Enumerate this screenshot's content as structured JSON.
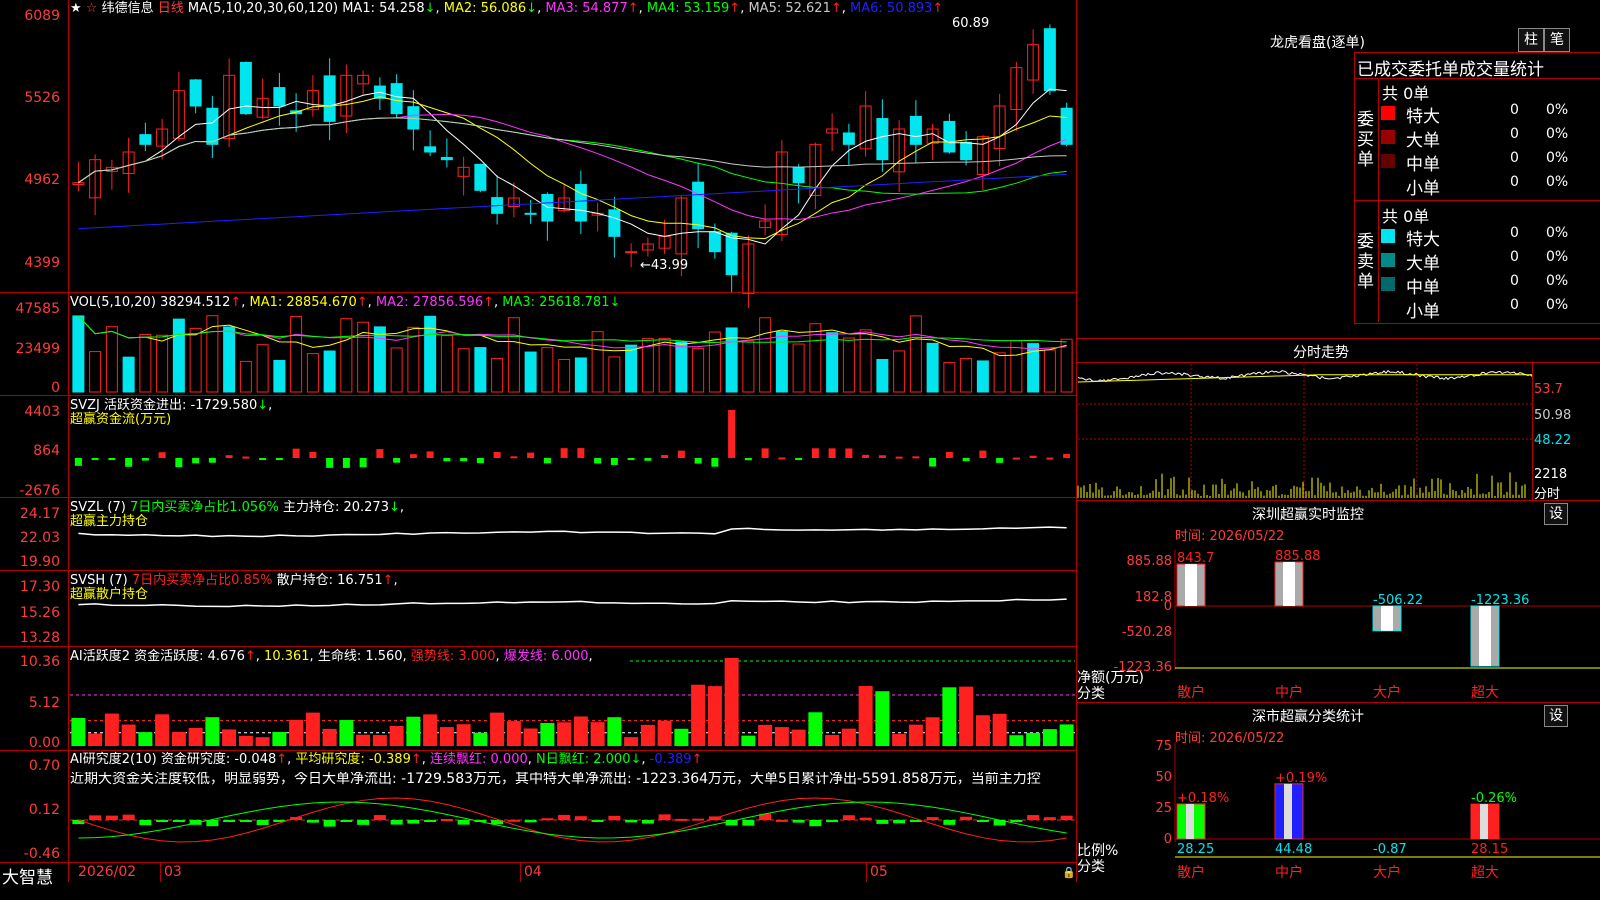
{
  "colors": {
    "up": "#ff2020",
    "down": "#00e5ee",
    "grid": "#b00000",
    "axis": "#ff3b3b",
    "yellow": "#ffff00",
    "magenta": "#ff33ff",
    "green": "#00ff00",
    "blue": "#2020ff",
    "white": "#ffffff",
    "gray": "#c8c8c8"
  },
  "main": {
    "title_stock": "纬德信息",
    "title_period": "日线",
    "ma_params": "MA(5,10,20,30,60,120)",
    "ma": [
      {
        "label": "MA1: 54.258",
        "arrow": "↓",
        "color": "#ffffff"
      },
      {
        "label": "MA2: 56.086",
        "arrow": "↓",
        "color": "#ffff00"
      },
      {
        "label": "MA3: 54.877",
        "arrow": "↑",
        "color": "#ff33ff"
      },
      {
        "label": "MA4: 53.159",
        "arrow": "↑",
        "color": "#00ff00"
      },
      {
        "label": "MA5: 52.621",
        "arrow": "↑",
        "color": "#c8c8c8"
      },
      {
        "label": "MA6: 50.893",
        "arrow": "↑",
        "color": "#2020ff"
      }
    ],
    "yaxis": [
      "6089",
      "5526",
      "4962",
      "4399"
    ],
    "high_note": "60.89",
    "low_note": "43.99"
  },
  "vol": {
    "title": "VOL(5,10,20)",
    "value": "38294.512",
    "arrow": "↑",
    "ma": [
      {
        "label": "MA1: 28854.670",
        "arrow": "↑",
        "color": "#ffff00"
      },
      {
        "label": "MA2: 27856.596",
        "arrow": "↑",
        "color": "#ff33ff"
      },
      {
        "label": "MA3: 25618.781",
        "arrow": "↓",
        "color": "#00ff00"
      }
    ],
    "yaxis": [
      "47585",
      "23499",
      "0"
    ]
  },
  "svzj": {
    "title": "SVZJ  活跃资金进出: -1729.580",
    "arrow": "↓",
    "suffix": ",",
    "sub": "超赢资金流(万元)",
    "yaxis": [
      "4403",
      "864",
      "-2676"
    ]
  },
  "svzl": {
    "title": "SVZL (7)",
    "pct": "7日内买卖净占比1.056%",
    "label": "主力持仓: 20.273",
    "arrow": "↓",
    "suffix": ",",
    "sub": "超赢主力持仓",
    "yaxis": [
      "24.17",
      "22.03",
      "19.90"
    ]
  },
  "svsh": {
    "title": "SVSH (7)",
    "pct": "7日内买卖净占比0.85%",
    "label": "散户持仓: 16.751",
    "arrow": "↑",
    "suffix": ",",
    "sub": "超赢散户持仓",
    "yaxis": [
      "17.30",
      "15.26",
      "13.28"
    ]
  },
  "ai_active": {
    "title": "AI活跃度2",
    "l1": "资金活跃度: 4.676",
    "a1": "↑",
    "l2": "10.361",
    "l3": "生命线: 1.560",
    "l4": "强势线: 3.000",
    "l5": "爆发线: 6.000",
    "yaxis": [
      "10.36",
      "5.12",
      "0.00"
    ]
  },
  "ai_research": {
    "title": "AI研究度2(10)",
    "l1": "资金研究度: -0.048",
    "a1": "↑",
    "l2": "平均研究度: -0.389",
    "a2": "↑",
    "l3": "连续飘红: 0.000",
    "l4": "N日飘红: 2.000",
    "a4": "↓",
    "l5": "-0.389",
    "a5": "↑",
    "comment": "近期大资金关注度较低，明显弱势，今日大单净流出: -1729.583万元，其中特大单净流出: -1223.364万元，大单5日累计净出-5591.858万元，当前主力控",
    "yaxis": [
      "0.70",
      "0.12",
      "-0.46"
    ]
  },
  "bottom": {
    "brand": "大智慧",
    "dates": [
      "2026/02",
      "03",
      "04",
      "05"
    ]
  },
  "lhb": {
    "title": "龙虎看盘(逐单)",
    "btn1": "柱",
    "btn2": "笔",
    "header": "已成交委托单成交量统计",
    "buy_label": "委买单",
    "sell_label": "委卖单",
    "buy_total": "共 0单",
    "sell_total": "共 0单",
    "buy_rows": [
      {
        "name": "特大",
        "val": "0",
        "pct": "0%",
        "color": "#ff0000"
      },
      {
        "name": "大单",
        "val": "0",
        "pct": "0%",
        "color": "#990000"
      },
      {
        "name": "中单",
        "val": "0",
        "pct": "0%",
        "color": "#660000"
      },
      {
        "name": "小单",
        "val": "0",
        "pct": "0%",
        "color": ""
      }
    ],
    "sell_rows": [
      {
        "name": "特大",
        "val": "0",
        "pct": "0%",
        "color": "#00e5ee"
      },
      {
        "name": "大单",
        "val": "0",
        "pct": "0%",
        "color": "#008b8b"
      },
      {
        "name": "中单",
        "val": "0",
        "pct": "0%",
        "color": "#006a6a"
      },
      {
        "name": "小单",
        "val": "0",
        "pct": "0%",
        "color": ""
      }
    ]
  },
  "fenshi": {
    "title": "分时走势",
    "yaxis": [
      "53.7",
      "50.98",
      "48.22",
      "2218",
      "分时"
    ]
  },
  "szmon": {
    "title": "深圳超赢实时监控",
    "btn": "设",
    "time": "时间: 2026/05/22",
    "yaxis": [
      "885.88",
      "182.8",
      "0",
      "-520.28",
      "-1223.36"
    ],
    "ylabel": "净额(万元)",
    "xlabel": "分类",
    "cats": [
      {
        "name": "散户",
        "val": "843.7",
        "num": 843.7
      },
      {
        "name": "中户",
        "val": "885.88",
        "num": 885.88
      },
      {
        "name": "大户",
        "val": "-506.22",
        "num": -506.22
      },
      {
        "name": "超大",
        "val": "-1223.36",
        "num": -1223.36
      }
    ]
  },
  "szcls": {
    "title": "深市超赢分类统计",
    "btn": "设",
    "time": "时间: 2026/05/22",
    "yaxis": [
      "75",
      "50",
      "25",
      "0"
    ],
    "ylabel": "比例%",
    "xlabel": "分类",
    "cats": [
      {
        "name": "散户",
        "val": "28.25",
        "chg": "+0.18%",
        "num": 28.25,
        "color": "#00ff00"
      },
      {
        "name": "中户",
        "val": "44.48",
        "chg": "+0.19%",
        "num": 44.48,
        "color": "#2020ff"
      },
      {
        "name": "大户",
        "val": "-0.87",
        "chg": "",
        "num": -0.87,
        "color": "#00e5ee"
      },
      {
        "name": "超大",
        "val": "28.15",
        "chg": "-0.26%",
        "num": 28.15,
        "color": "#ff2020"
      }
    ]
  }
}
